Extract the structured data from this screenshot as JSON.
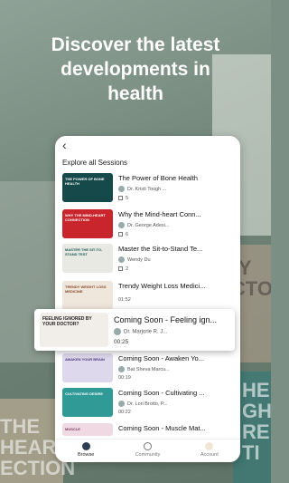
{
  "hero": {
    "title": "Discover the latest\ndevelopments in\nhealth"
  },
  "background": {
    "words": [
      "BY",
      "DCTOR",
      "THE",
      "HEAR",
      "ECTION",
      "HE",
      "GH",
      "RE",
      "TI"
    ]
  },
  "screen": {
    "back_icon": "chevron-left-icon",
    "section_title": "Explore all Sessions",
    "sessions": [
      {
        "title": "The Power of Bone Health",
        "author": "Dr. Kristi Tough ...",
        "count": "5",
        "thumb_text": "THE POWER OF BONE HEALTH",
        "thumb_color": "#15494a"
      },
      {
        "title": "Why the Mind-heart Conn...",
        "author": "Dr. George Adesi...",
        "count": "6",
        "thumb_text": "WHY THE MIND-HEART CONNECTION",
        "thumb_color": "#c9252c"
      },
      {
        "title": "Master the Sit-to-Stand Te...",
        "author": "Wendy Du",
        "count": "2",
        "thumb_text": "MASTER THE SIT-TO-STAND TEST",
        "thumb_color": "#e7e9e2"
      },
      {
        "title": "Trendy Weight Loss Medici...",
        "time": "01:52",
        "thumb_text": "TRENDY WEIGHT LOSS MEDICINE",
        "thumb_color": "#efe6dc"
      },
      {
        "title": "Coming Soon - Awaken Yo...",
        "author": "Bat Sheva Marcu...",
        "time": "00:19",
        "thumb_text": "AWAKEN YOUR BRAIN",
        "thumb_color": "#ded8ec"
      },
      {
        "title": "Coming Soon - Cultivating ...",
        "author": "Dr. Lori Brotto, P...",
        "time": "00:22",
        "thumb_text": "CULTIVATING DESIRE",
        "thumb_color": "#2f9a96"
      },
      {
        "title": "Coming Soon - Muscle Mat...",
        "thumb_text": "MUSCLE",
        "thumb_color": "#efd9e3"
      }
    ],
    "featured": {
      "title": "Coming Soon - Feeling ign...",
      "author": "Dr. Marjorie R. J...",
      "time": "00:25",
      "thumb_text": "FEELING IGNORED BY YOUR DOCTOR?"
    },
    "tabs": [
      {
        "label": "Browse",
        "icon": "play-circle-icon"
      },
      {
        "label": "Community",
        "icon": "people-icon"
      },
      {
        "label": "Account",
        "icon": "account-icon"
      }
    ]
  }
}
